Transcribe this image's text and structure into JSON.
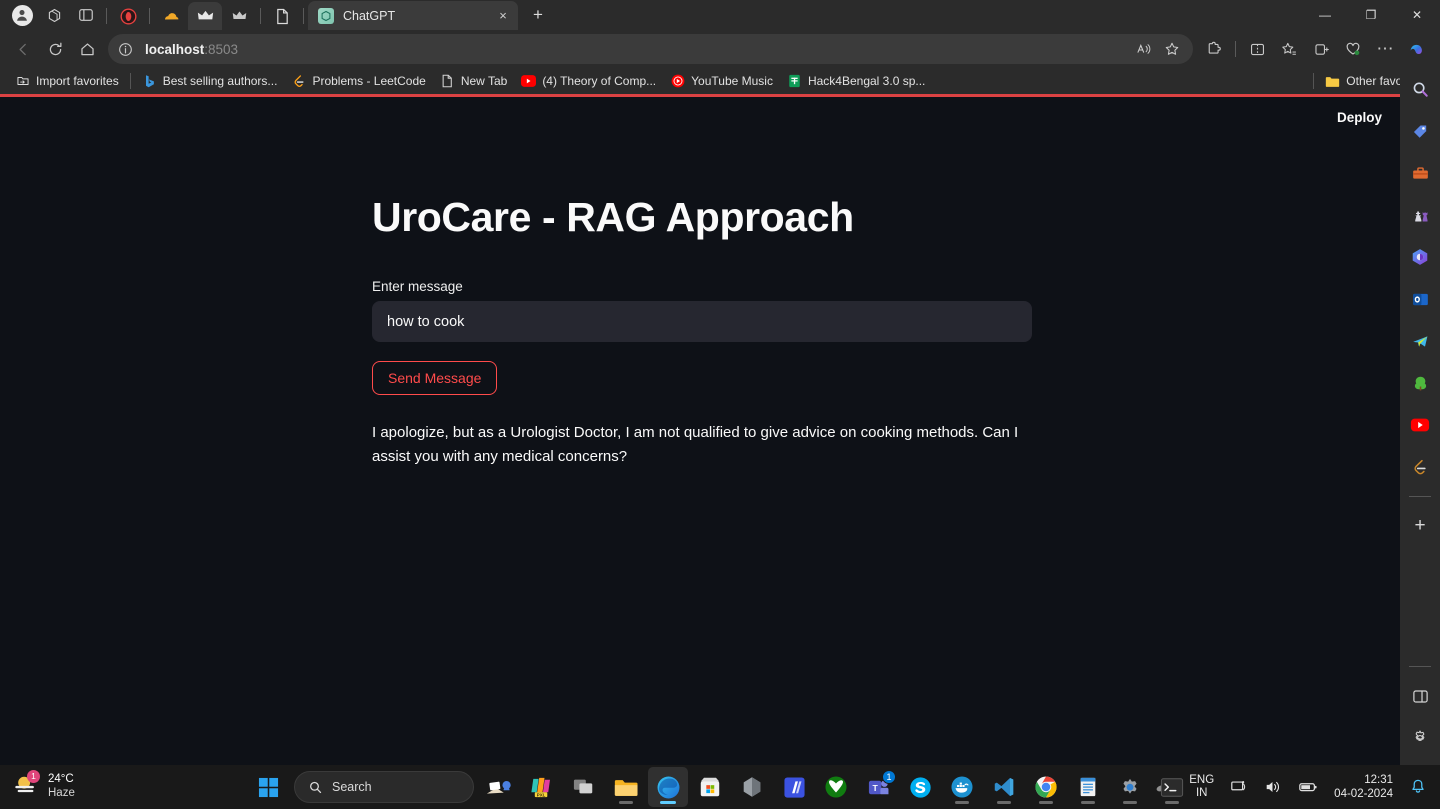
{
  "browser": {
    "tab_strip": {
      "profile_icon": "account-avatar-icon",
      "workspaces_icon": "workspaces-icon",
      "tab_actions_icon": "vertical-tabs-icon",
      "pinned_tabs": [
        {
          "name": "opera-gx-pinned-tab",
          "icon": "opera-icon"
        },
        {
          "name": "cloud-pinned-tab",
          "icon": "cloud-icon"
        },
        {
          "name": "crown-tab-active",
          "icon": "crown-icon"
        },
        {
          "name": "crown-tab-2",
          "icon": "crown-icon"
        },
        {
          "name": "document-tab",
          "icon": "document-icon"
        }
      ],
      "active_tab_title": "ChatGPT",
      "close_label": "×",
      "new_tab_label": "+"
    },
    "window_controls": {
      "minimize": "—",
      "maximize": "❐",
      "close": "✕"
    },
    "nav": {
      "back": "back-arrow",
      "reload": "reload",
      "home": "home",
      "url_host": "localhost",
      "url_port": ":8503",
      "read_aloud": "A",
      "favorite": "star",
      "split_screen": "split-screen",
      "favorites_menu": "favorites",
      "collections": "collections",
      "browser_essentials": "browser-essentials",
      "settings_more": "⋯",
      "copilot": "copilot"
    },
    "bookmarks": {
      "import_label": "Import favorites",
      "items": [
        {
          "label": "Best selling authors...",
          "icon": "bing-icon",
          "color": "#3a96dd"
        },
        {
          "label": "Problems - LeetCode",
          "icon": "leetcode-icon",
          "color": "#ffa116"
        },
        {
          "label": "New Tab",
          "icon": "page-icon",
          "color": "#cccccc"
        },
        {
          "label": "(4) Theory of Comp...",
          "icon": "youtube-icon",
          "color": "#ff0000"
        },
        {
          "label": "YouTube Music",
          "icon": "youtube-music-icon",
          "color": "#ff0000"
        },
        {
          "label": "Hack4Bengal 3.0 sp...",
          "icon": "sheets-icon",
          "color": "#0f9d58"
        }
      ],
      "other_favorites": "Other favorites"
    },
    "sidebar": {
      "items": [
        {
          "name": "sidebar-search",
          "icon": "magnifier-icon"
        },
        {
          "name": "sidebar-shopping",
          "icon": "price-tag-icon"
        },
        {
          "name": "sidebar-tools",
          "icon": "toolbox-icon"
        },
        {
          "name": "sidebar-games",
          "icon": "chess-icon"
        },
        {
          "name": "sidebar-office",
          "icon": "microsoft-365-icon"
        },
        {
          "name": "sidebar-outlook",
          "icon": "outlook-icon"
        },
        {
          "name": "sidebar-telegram",
          "icon": "telegram-icon"
        },
        {
          "name": "sidebar-ecosia",
          "icon": "tree-icon"
        },
        {
          "name": "sidebar-youtube",
          "icon": "youtube-icon"
        },
        {
          "name": "sidebar-leetcode",
          "icon": "leetcode-icon"
        }
      ],
      "add_label": "+",
      "customize": "sidebar-toggle-icon",
      "settings": "gear-icon"
    }
  },
  "page": {
    "accent_color": "#ff4b4b",
    "background_color": "#0e1117",
    "surface_color": "#262730",
    "header": {
      "deploy_label": "Deploy",
      "menu_icon": "kebab-menu-icon"
    },
    "title": "UroCare - RAG Approach",
    "form": {
      "input_label": "Enter message",
      "input_value": "how to cook",
      "input_placeholder": "",
      "submit_label": "Send Message"
    },
    "response": "I apologize, but as a Urologist Doctor, I am not qualified to give advice on cooking methods. Can I assist you with any medical concerns?"
  },
  "taskbar": {
    "weather": {
      "temperature": "24°C",
      "condition": "Haze",
      "badge": "1"
    },
    "start_label": "start-button",
    "search_placeholder": "Search",
    "apps": [
      {
        "name": "taskbar-widgets",
        "icon": "widgets-icon",
        "open": false,
        "badge": ""
      },
      {
        "name": "taskbar-pixlr",
        "icon": "pixlr-icon",
        "open": false,
        "badge": ""
      },
      {
        "name": "taskbar-task-view",
        "icon": "task-view-icon",
        "open": false,
        "badge": ""
      },
      {
        "name": "taskbar-file-explorer",
        "icon": "folder-icon",
        "open": true,
        "badge": ""
      },
      {
        "name": "taskbar-edge",
        "icon": "edge-icon",
        "open": true,
        "badge": ""
      },
      {
        "name": "taskbar-microsoft-store",
        "icon": "store-icon",
        "open": false,
        "badge": ""
      },
      {
        "name": "taskbar-copilot",
        "icon": "copilot-icon",
        "open": false,
        "badge": ""
      },
      {
        "name": "taskbar-clipchamp",
        "icon": "clipchamp-icon",
        "open": false,
        "badge": ""
      },
      {
        "name": "taskbar-xbox",
        "icon": "xbox-icon",
        "open": false,
        "badge": ""
      },
      {
        "name": "taskbar-teams",
        "icon": "teams-icon",
        "open": false,
        "badge": "1"
      },
      {
        "name": "taskbar-skype",
        "icon": "skype-icon",
        "open": false,
        "badge": ""
      },
      {
        "name": "taskbar-docker",
        "icon": "docker-icon",
        "open": true,
        "badge": ""
      },
      {
        "name": "taskbar-vscode",
        "icon": "vscode-icon",
        "open": true,
        "badge": ""
      },
      {
        "name": "taskbar-chrome",
        "icon": "chrome-icon",
        "open": true,
        "badge": ""
      },
      {
        "name": "taskbar-notepad",
        "icon": "notepad-icon",
        "open": true,
        "badge": ""
      },
      {
        "name": "taskbar-settings",
        "icon": "settings-gear-icon",
        "open": true,
        "badge": ""
      },
      {
        "name": "taskbar-terminal",
        "icon": "terminal-icon",
        "open": true,
        "badge": ""
      }
    ],
    "tray": {
      "overflow": "⌃",
      "status_icon": "mic-muted-icon",
      "language": "ENG",
      "region": "IN",
      "network": "network-icon",
      "volume": "volume-icon",
      "battery": "battery-icon",
      "time": "12:31",
      "date": "04-02-2024",
      "notifications": "bell-icon"
    }
  }
}
